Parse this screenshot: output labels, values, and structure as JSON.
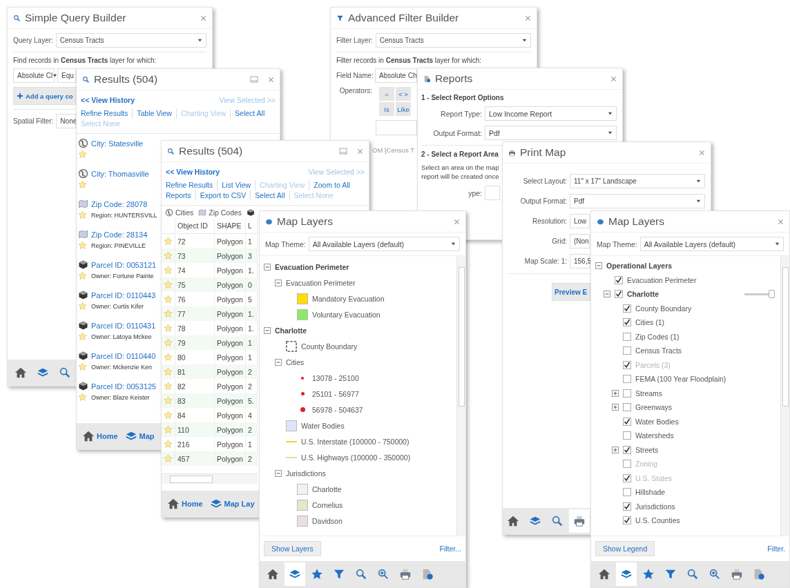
{
  "simple_query_builder": {
    "title": "Simple Query Builder",
    "query_layer": {
      "label": "Query Layer:",
      "value": "Census Tracts"
    },
    "instruction": "Find records in **Census Tracts** layer for which:",
    "field": "Absolute Cl",
    "operator": "Equ",
    "add_button": "Add a query co",
    "spatial_filter": {
      "label": "Spatial Filter:",
      "value": "None"
    },
    "toolbar": [
      {
        "kind": "home",
        "selected": false
      },
      {
        "kind": "layers",
        "selected": false
      },
      {
        "kind": "search",
        "selected": false
      }
    ]
  },
  "advanced_filter_builder": {
    "title": "Advanced Filter Builder",
    "filter_layer": {
      "label": "Filter Layer:",
      "value": "Census Tracts"
    },
    "instruction": "Filter records in **Census Tracts** layer for which:",
    "field_name": {
      "label": "Field Name:",
      "value": "Absolute Ch"
    },
    "operators": {
      "label": "Operators:",
      "buttons": [
        "=",
        "< >",
        "Is",
        "Like"
      ]
    },
    "expression": "OM [Census T"
  },
  "results_list": {
    "title": "Results (504)",
    "view_history": "<< View History",
    "view_selected": "View Selected >>",
    "action_rows": [
      [
        {
          "label": "Refine Results",
          "disabled": false
        },
        {
          "label": "Table View",
          "disabled": false
        },
        {
          "label": "Charting View",
          "disabled": true
        },
        {
          "label": "Select All",
          "disabled": false
        }
      ],
      [
        {
          "label": "Select None",
          "disabled": true
        }
      ]
    ],
    "items": [
      {
        "kind": "city",
        "title": "City: Statesville"
      },
      {
        "kind": "city",
        "title": "City: Thomasville"
      },
      {
        "kind": "zip",
        "title": "Zip Code: 28078",
        "detail": "Region: HUNTERSVILL"
      },
      {
        "kind": "zip",
        "title": "Zip Code: 28134",
        "detail": "Region: PINEVILLE"
      },
      {
        "kind": "parcel",
        "title": "Parcel ID: 0053121",
        "detail": "Owner: Fortune Painte"
      },
      {
        "kind": "parcel",
        "title": "Parcel ID: 0110443",
        "detail": "Owner: Curtis Kifer"
      },
      {
        "kind": "parcel",
        "title": "Parcel ID: 0110431",
        "detail": "Owner: Latoya Mckee"
      },
      {
        "kind": "parcel",
        "title": "Parcel ID: 0110440",
        "detail": "Owner: Mckenzie Ken"
      },
      {
        "kind": "parcel",
        "title": "Parcel ID: 0053125",
        "detail": "Owner: Blaze Keister"
      }
    ],
    "toolbar": [
      {
        "kind": "home",
        "label": "Home",
        "selected": false
      },
      {
        "kind": "layers",
        "label": "Map",
        "selected": false
      }
    ]
  },
  "reports": {
    "title": "Reports",
    "section_1": "1 - Select Report Options",
    "report_type": {
      "label": "Report Type:",
      "value": "Low Income Report"
    },
    "output_format": {
      "label": "Output Format:",
      "value": "Pdf"
    },
    "section_2": "2 - Select a Report Area",
    "instruction_lines": [
      "Select an area on the map",
      "report will be created once"
    ],
    "area_type": {
      "label": "ype:"
    }
  },
  "results_table": {
    "title": "Results (504)",
    "view_history": "<< View History",
    "view_selected": "View Selected >>",
    "action_rows": [
      [
        {
          "label": "Refine Results",
          "disabled": false
        },
        {
          "label": "List View",
          "disabled": false
        },
        {
          "label": "Charting View",
          "disabled": true
        },
        {
          "label": "Zoom to All",
          "disabled": false
        }
      ],
      [
        {
          "label": "Reports",
          "disabled": false
        },
        {
          "label": "Export to CSV",
          "disabled": false
        },
        {
          "label": "Select All",
          "disabled": false
        },
        {
          "label": "Select None",
          "disabled": true
        }
      ]
    ],
    "tabs": [
      {
        "kind": "city",
        "label": "Cities"
      },
      {
        "kind": "zip",
        "label": "Zip Codes"
      },
      {
        "kind": "parcel"
      }
    ],
    "table": {
      "columns": [
        "Object ID",
        "SHAPE",
        "L"
      ],
      "rows": [
        {
          "cells": [
            "72",
            "Polygon",
            "1"
          ]
        },
        {
          "cells": [
            "73",
            "Polygon",
            "3"
          ]
        },
        {
          "cells": [
            "74",
            "Polygon",
            "1."
          ]
        },
        {
          "cells": [
            "75",
            "Polygon",
            "0"
          ]
        },
        {
          "cells": [
            "76",
            "Polygon",
            "5"
          ]
        },
        {
          "cells": [
            "77",
            "Polygon",
            "1."
          ]
        },
        {
          "cells": [
            "78",
            "Polygon",
            "1."
          ]
        },
        {
          "cells": [
            "79",
            "Polygon",
            "1"
          ]
        },
        {
          "cells": [
            "80",
            "Polygon",
            "1"
          ]
        },
        {
          "cells": [
            "81",
            "Polygon",
            "2"
          ]
        },
        {
          "cells": [
            "82",
            "Polygon",
            "2"
          ]
        },
        {
          "cells": [
            "83",
            "Polygon",
            "5."
          ]
        },
        {
          "cells": [
            "84",
            "Polygon",
            "4"
          ]
        },
        {
          "cells": [
            "110",
            "Polygon",
            "2"
          ]
        },
        {
          "cells": [
            "216",
            "Polygon",
            "1"
          ]
        },
        {
          "cells": [
            "457",
            "Polygon",
            "2"
          ]
        }
      ]
    },
    "toolbar": [
      {
        "kind": "home",
        "label": "Home",
        "selected": false
      },
      {
        "kind": "layers",
        "label": "Map Lay",
        "selected": false
      }
    ]
  },
  "print_map": {
    "title": "Print Map",
    "fields": [
      {
        "kind": "select",
        "label": "Select Layout:",
        "value": "11\" x 17\" Landscape"
      },
      {
        "kind": "select",
        "label": "Output Format:",
        "value": "Pdf"
      },
      {
        "kind": "select",
        "label": "Resolution:",
        "value": "Low"
      },
      {
        "kind": "select",
        "label": "Grid:",
        "value": "(Non"
      },
      {
        "kind": "input",
        "label": "Map Scale: 1:",
        "value": "156,5"
      }
    ],
    "preview_button": "Preview E",
    "toolbar": [
      {
        "kind": "home",
        "selected": false
      },
      {
        "kind": "layers",
        "selected": false
      },
      {
        "kind": "search",
        "selected": false
      },
      {
        "kind": "print",
        "selected": true
      }
    ]
  },
  "map_layers_legend": {
    "title": "Map Layers",
    "theme": {
      "label": "Map Theme:",
      "value": "All Available Layers (default)"
    },
    "tree": [
      {
        "kind": "service",
        "label": "Evacuation Perimeter",
        "expanded": true,
        "children": [
          {
            "kind": "group",
            "label": "Evacuation Perimeter",
            "expanded": true,
            "children": [
              {
                "kind": "swatch",
                "label": "Mandatory Evacuation",
                "color": "#ffdd00"
              },
              {
                "kind": "swatch",
                "label": "Voluntary Evacuation",
                "color": "#8ee86a"
              }
            ]
          }
        ]
      },
      {
        "kind": "service",
        "label": "Charlotte",
        "expanded": true,
        "children": [
          {
            "kind": "boundary",
            "label": "County Boundary"
          },
          {
            "kind": "group",
            "label": "Cities",
            "expanded": true,
            "children": [
              {
                "kind": "smalldot",
                "label": "13078 - 25100",
                "color": "#e02020"
              },
              {
                "kind": "middot",
                "label": "25101 - 56977",
                "color": "#e02020"
              },
              {
                "kind": "bigdot",
                "label": "56978 - 504637",
                "color": "#e02020"
              }
            ]
          },
          {
            "kind": "swatch",
            "label": "Water Bodies",
            "color": "#dde6f6"
          },
          {
            "kind": "line",
            "label": "U.S. Interstate (100000 - 750000)",
            "color": "#f2d23a"
          },
          {
            "kind": "line",
            "label": "U.S. Highways (100000 - 350000)",
            "color": "#d6e49a"
          },
          {
            "kind": "group",
            "label": "Jurisdictions",
            "expanded": true,
            "children": [
              {
                "kind": "swatch",
                "label": "Charlotte",
                "color": "#f3f3ee"
              },
              {
                "kind": "swatch",
                "label": "Cornelius",
                "color": "#e8e6c8"
              },
              {
                "kind": "swatch",
                "label": "Davidson",
                "color": "#eadede"
              }
            ]
          }
        ]
      }
    ],
    "show_button": "Show Layers",
    "filter_link": "Filter...",
    "toolbar": [
      {
        "kind": "home",
        "selected": false
      },
      {
        "kind": "layers",
        "selected": true
      },
      {
        "kind": "star",
        "selected": false
      },
      {
        "kind": "filter",
        "selected": false
      },
      {
        "kind": "search",
        "selected": false
      },
      {
        "kind": "zoom",
        "selected": false
      },
      {
        "kind": "print",
        "selected": false
      },
      {
        "kind": "report",
        "selected": false
      }
    ]
  },
  "map_layers_toc": {
    "title": "Map Layers",
    "theme": {
      "label": "Map Theme:",
      "value": "All Available Layers (default)"
    },
    "tree": [
      {
        "kind": "root",
        "label": "Operational Layers",
        "expanded": true,
        "children": [
          {
            "kind": "layer",
            "label": "Evacuation Perimeter",
            "checked": true,
            "disabled": false
          },
          {
            "kind": "service",
            "label": "Charlotte",
            "checked": true,
            "disabled": false,
            "expanded": true,
            "level": 0.92,
            "children": [
              {
                "kind": "layer",
                "label": "County Boundary",
                "checked": true,
                "disabled": false
              },
              {
                "kind": "layer",
                "label": "Cities (1)",
                "checked": true,
                "disabled": false
              },
              {
                "kind": "layer",
                "label": "Zip Codes (1)",
                "checked": false,
                "disabled": false
              },
              {
                "kind": "layer",
                "label": "Census Tracts",
                "checked": false,
                "disabled": false
              },
              {
                "kind": "layer",
                "label": "Parcels (3)",
                "checked": true,
                "disabled": true
              },
              {
                "kind": "layer",
                "label": "FEMA (100 Year Floodplain)",
                "checked": false,
                "disabled": false
              },
              {
                "kind": "layer",
                "label": "Streams",
                "checked": false,
                "disabled": false,
                "expanded": false
              },
              {
                "kind": "layer",
                "label": "Greenways",
                "checked": false,
                "disabled": false,
                "expanded": false
              },
              {
                "kind": "layer",
                "label": "Water Bodies",
                "checked": true,
                "disabled": false
              },
              {
                "kind": "layer",
                "label": "Watersheds",
                "checked": false,
                "disabled": false
              },
              {
                "kind": "layer",
                "label": "Streets",
                "checked": true,
                "disabled": false,
                "expanded": false
              },
              {
                "kind": "layer",
                "label": "Zoning",
                "checked": false,
                "disabled": true
              },
              {
                "kind": "layer",
                "label": "U.S. States",
                "checked": true,
                "disabled": true
              },
              {
                "kind": "layer",
                "label": "Hillshade",
                "checked": false,
                "disabled": false
              },
              {
                "kind": "layer",
                "label": "Jurisdictions",
                "checked": true,
                "disabled": false
              },
              {
                "kind": "layer",
                "label": "U.S. Counties",
                "checked": true,
                "disabled": false
              }
            ]
          }
        ]
      }
    ],
    "show_button": "Show Legend",
    "filter_link": "Filter.",
    "toolbar": [
      {
        "kind": "home",
        "selected": false
      },
      {
        "kind": "layers",
        "selected": true
      },
      {
        "kind": "star",
        "selected": false
      },
      {
        "kind": "filter",
        "selected": false
      },
      {
        "kind": "search",
        "selected": false
      },
      {
        "kind": "zoom",
        "selected": false
      },
      {
        "kind": "print",
        "selected": false
      },
      {
        "kind": "report",
        "selected": false
      }
    ]
  }
}
